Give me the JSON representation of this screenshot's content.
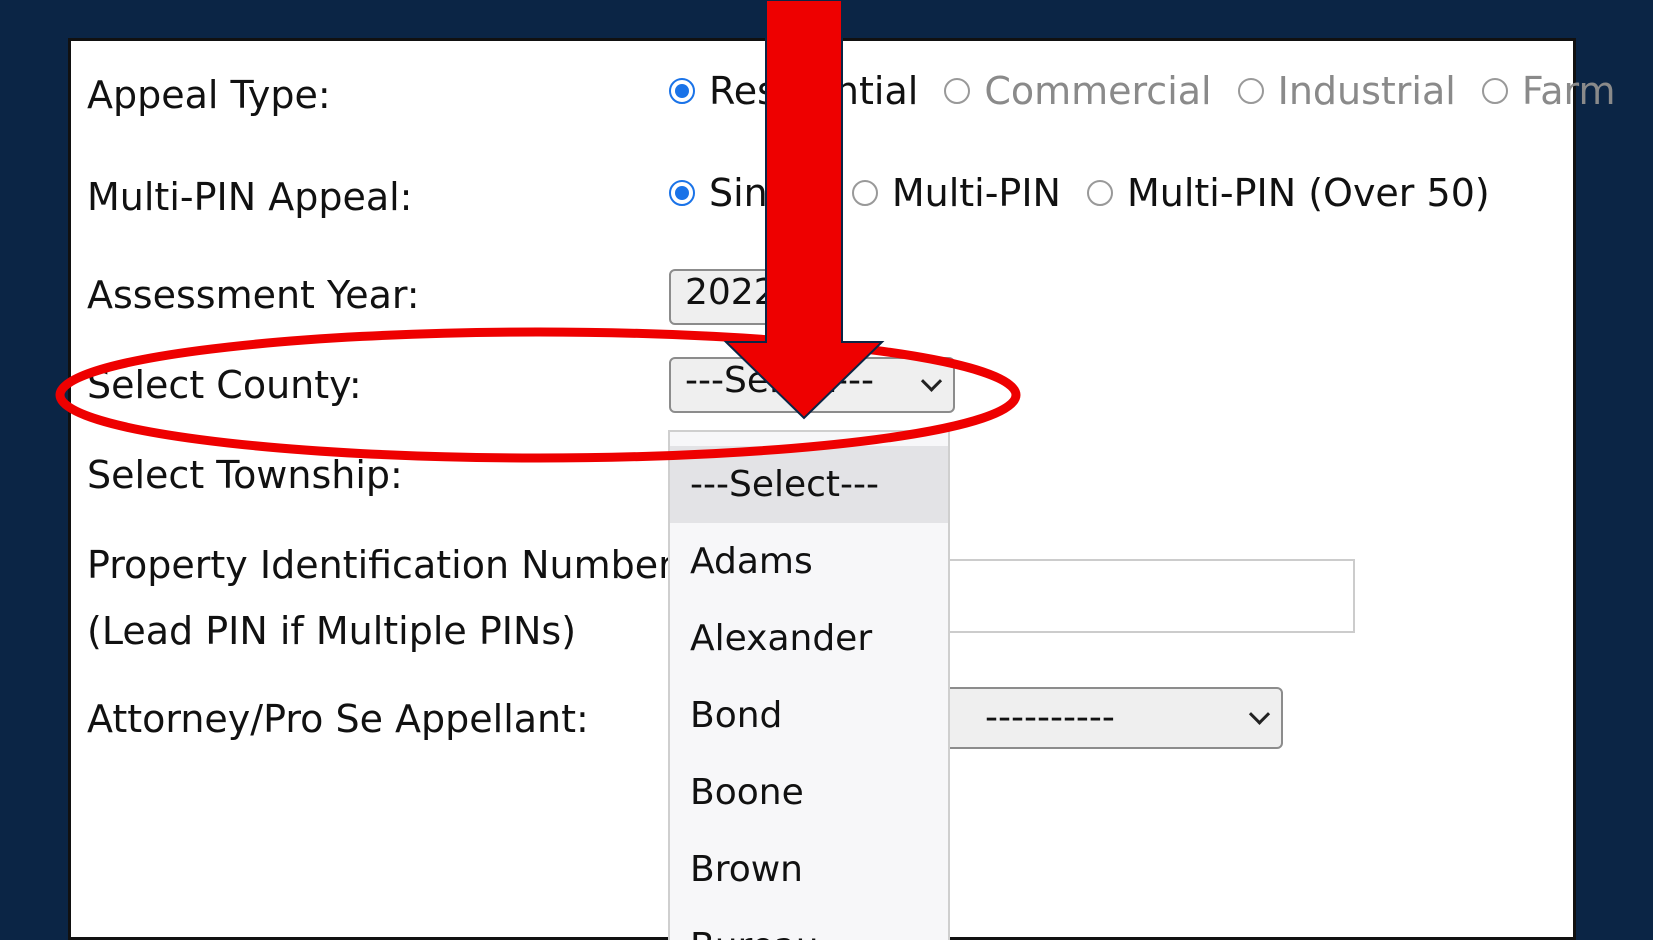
{
  "form": {
    "appeal_type": {
      "label": "Appeal Type:",
      "options": [
        {
          "text": "Residential",
          "checked": true
        },
        {
          "text": "Commercial",
          "checked": false
        },
        {
          "text": "Industrial",
          "checked": false
        },
        {
          "text": "Farm",
          "checked": false
        }
      ]
    },
    "multi_pin": {
      "label": "Multi-PIN Appeal:",
      "options": [
        {
          "text": "Single",
          "checked": true
        },
        {
          "text": "Multi-PIN",
          "checked": false
        },
        {
          "text": "Multi-PIN (Over 50)",
          "checked": false
        }
      ]
    },
    "assessment_year": {
      "label": "Assessment Year:",
      "value": "2022"
    },
    "county": {
      "label": "Select County:",
      "value": "---Select---",
      "options": [
        "---Select---",
        "Adams",
        "Alexander",
        "Bond",
        "Boone",
        "Brown",
        "Bureau"
      ]
    },
    "township": {
      "label": "Select Township:"
    },
    "pin": {
      "label": "Property Identification Number:",
      "sublabel": "(Lead PIN if Multiple PINs)",
      "value": ""
    },
    "attorney": {
      "label": "Attorney/Pro Se Appellant:",
      "value": "----------"
    }
  },
  "annotation": {
    "arrow_color": "#ee0000",
    "ellipse_color": "#ee0000"
  }
}
